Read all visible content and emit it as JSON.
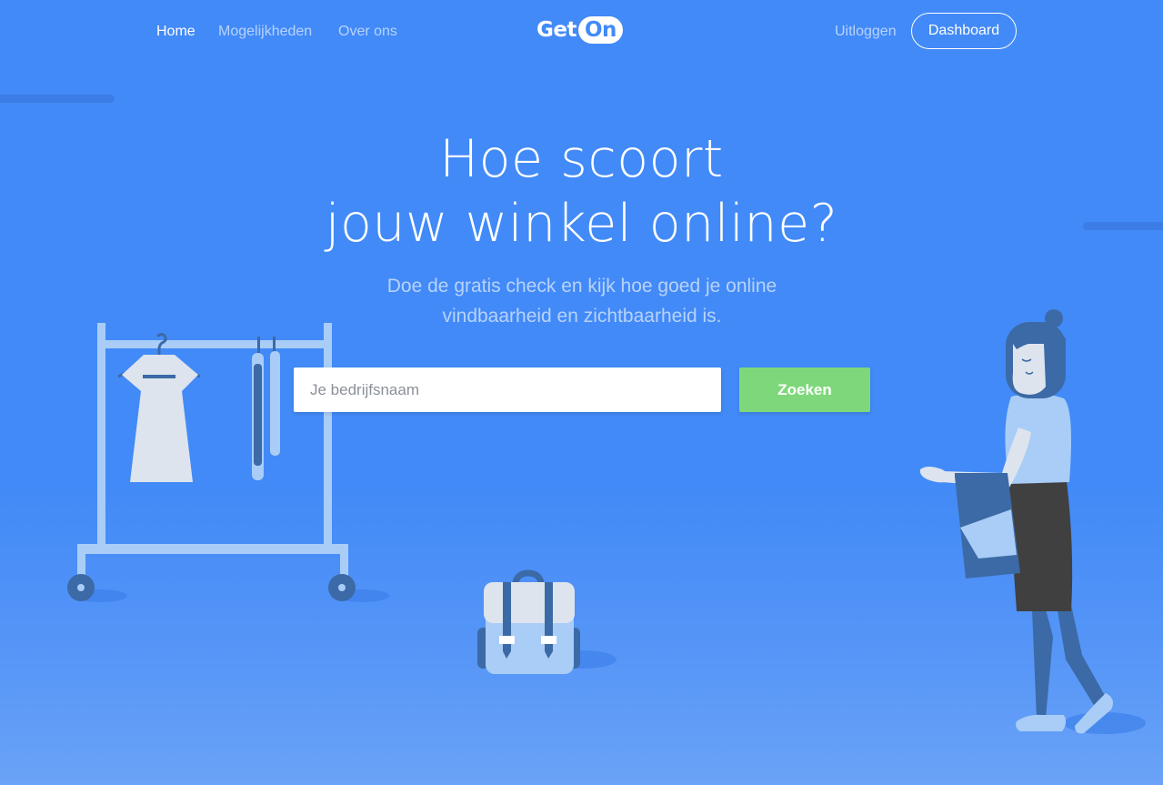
{
  "nav": {
    "left_links": [
      "Home",
      "Mogelijkheden",
      "Over ons"
    ],
    "active": "Home",
    "logo": {
      "part1": "Get",
      "part2": "On"
    },
    "logout_label": "Uitloggen",
    "dashboard_label": "Dashboard"
  },
  "hero": {
    "title_line1": "Hoe scoort",
    "title_line2": "jouw winkel online?",
    "subtitle_line1": "Doe de gratis check en kijk hoe goed je online",
    "subtitle_line2": "vindbaarheid en zichtbaarheid is."
  },
  "search": {
    "placeholder": "Je bedrijfsnaam",
    "value": "",
    "button_label": "Zoeken"
  },
  "colors": {
    "background": "#428af7",
    "button_green": "#7ed87b",
    "illustration_light": "#a9cdf7",
    "illustration_dark": "#3b6aa6"
  }
}
